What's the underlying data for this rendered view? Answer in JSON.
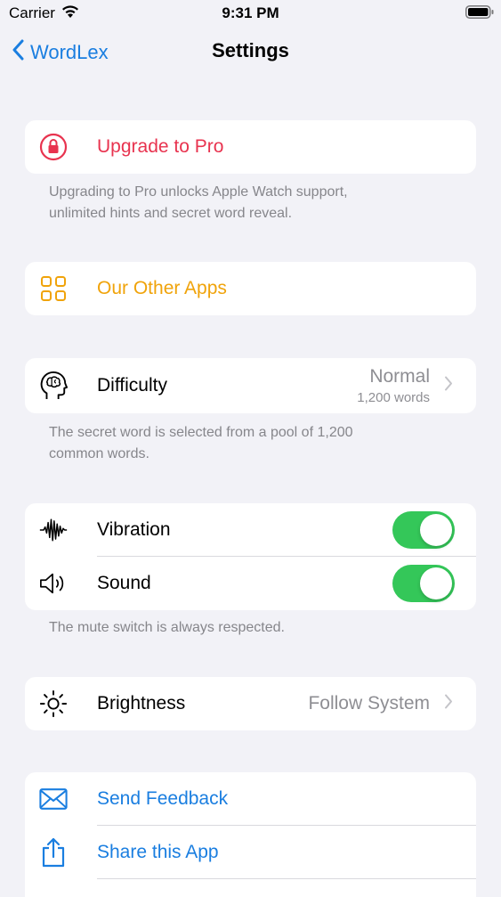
{
  "status": {
    "carrier": "Carrier",
    "time": "9:31 PM"
  },
  "nav": {
    "back_label": "WordLex",
    "title": "Settings"
  },
  "upgrade": {
    "label": "Upgrade to Pro",
    "footer_line1": "Upgrading to Pro unlocks Apple Watch support,",
    "footer_line2": "unlimited hints and secret word reveal."
  },
  "apps": {
    "label": "Our Other Apps"
  },
  "difficulty": {
    "label": "Difficulty",
    "value": "Normal",
    "subvalue": "1,200 words",
    "footer_line1": "The secret word is selected from a pool of 1,200",
    "footer_line2": "common words."
  },
  "feedback_group": {
    "vibration_label": "Vibration",
    "vibration_on": true,
    "sound_label": "Sound",
    "sound_on": true,
    "footer": "The mute switch is always respected."
  },
  "brightness": {
    "label": "Brightness",
    "value": "Follow System"
  },
  "links": {
    "send_feedback": "Send Feedback",
    "share_app": "Share this App"
  },
  "colors": {
    "accent": "#1a7ee0",
    "pro": "#e8334f",
    "apps": "#f0a30a",
    "toggle_on": "#34c759",
    "secondary": "#8e8e93"
  },
  "icons": [
    "lock-icon",
    "grid-icon",
    "brain-head-icon",
    "waveform-icon",
    "speaker-icon",
    "sun-icon",
    "envelope-icon",
    "share-icon",
    "chevron-right-icon",
    "chevron-left-icon"
  ]
}
